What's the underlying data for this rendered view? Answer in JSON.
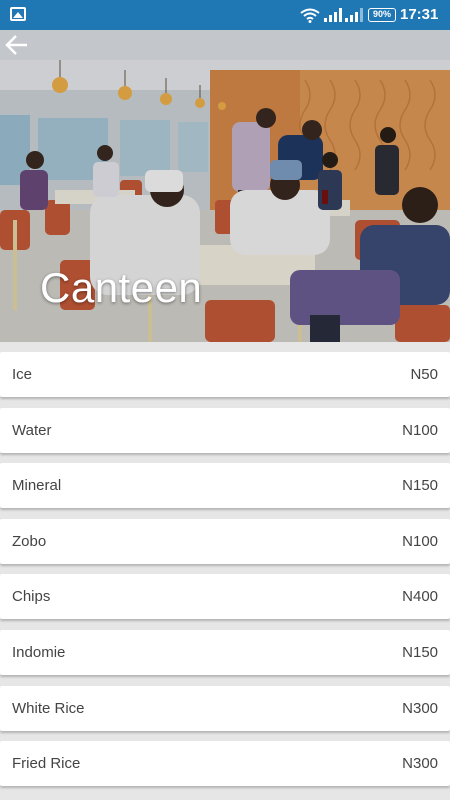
{
  "status_bar": {
    "battery": "90%",
    "time": "17:31"
  },
  "header": {
    "title": "Canteen",
    "back_icon": "arrow-left-icon"
  },
  "menu": {
    "items": [
      {
        "name": "Ice",
        "price": "N50"
      },
      {
        "name": "Water",
        "price": "N100"
      },
      {
        "name": "Mineral",
        "price": "N150"
      },
      {
        "name": "Zobo",
        "price": "N100"
      },
      {
        "name": "Chips",
        "price": "N400"
      },
      {
        "name": "Indomie",
        "price": "N150"
      },
      {
        "name": "White Rice",
        "price": "N300"
      },
      {
        "name": "Fried Rice",
        "price": "N300"
      }
    ]
  },
  "colors": {
    "status_bar": "#1f77b4",
    "background": "#e6e6e6",
    "card": "#ffffff"
  }
}
